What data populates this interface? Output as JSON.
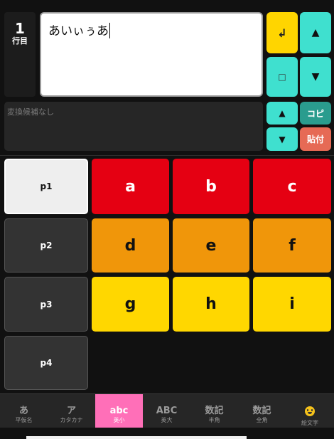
{
  "line_indicator": {
    "number": "1",
    "label": "行目"
  },
  "editor": {
    "text": "あいぃぅあ"
  },
  "controls": {
    "enter": "↲",
    "up": "▲",
    "space": "□",
    "down": "▼",
    "cand_up": "▲",
    "cand_down": "▼",
    "copy": "コピ",
    "paste": "貼付"
  },
  "candidates": {
    "placeholder": "変換候補なし"
  },
  "pages": [
    "p1",
    "p2",
    "p3",
    "p4"
  ],
  "keys": {
    "row1": [
      "a",
      "b",
      "c"
    ],
    "row2": [
      "d",
      "e",
      "f"
    ],
    "row3": [
      "g",
      "h",
      "i"
    ]
  },
  "colors": {
    "red": "#e50012",
    "orange": "#f0960a",
    "yellow": "#ffd700",
    "teal": "#3fe0cf",
    "pink": "#ff6fb8"
  },
  "tabs": [
    {
      "main": "あ",
      "sub": "平仮名"
    },
    {
      "main": "ア",
      "sub": "カタカナ"
    },
    {
      "main": "abc",
      "sub": "英小",
      "active": true
    },
    {
      "main": "ABC",
      "sub": "英大"
    },
    {
      "main": "数記",
      "sub": "半角"
    },
    {
      "main": "数記",
      "sub": "全角"
    },
    {
      "icon": "smiley-icon",
      "sub": "絵文字"
    }
  ]
}
